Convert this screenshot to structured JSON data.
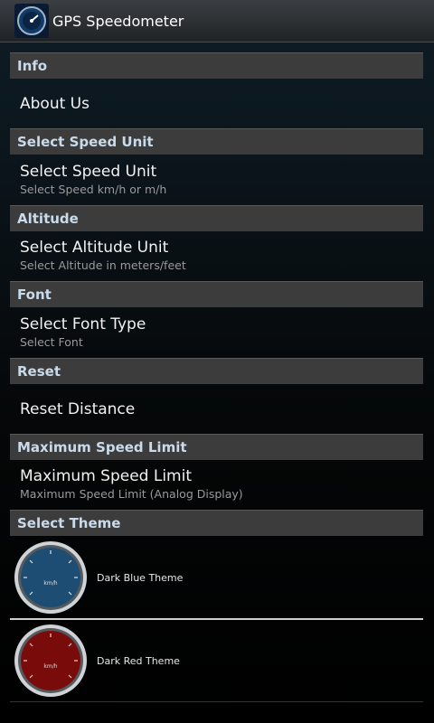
{
  "app": {
    "title": "GPS Speedometer"
  },
  "sections": {
    "info": {
      "header": "Info",
      "item_title": "About Us"
    },
    "speed": {
      "header": "Select Speed Unit",
      "item_title": "Select Speed Unit",
      "item_sub": "Select Speed km/h or m/h"
    },
    "altitude": {
      "header": "Altitude",
      "item_title": "Select Altitude Unit",
      "item_sub": "Select Altitude in meters/feet"
    },
    "font": {
      "header": "Font",
      "item_title": "Select Font Type",
      "item_sub": "Select Font"
    },
    "reset": {
      "header": "Reset",
      "item_title": "Reset Distance"
    },
    "maxspeed": {
      "header": "Maximum Speed Limit",
      "item_title": "Maximum Speed Limit",
      "item_sub": "Maximum Speed Limit (Analog Display)"
    },
    "theme": {
      "header": "Select Theme",
      "items": [
        {
          "label": "Dark Blue Theme",
          "gauge_unit": "km/h",
          "color": "#1e4d73",
          "icon": "speedometer-blue-icon"
        },
        {
          "label": "Dark Red Theme",
          "gauge_unit": "km/h",
          "color": "#7a0b0b",
          "icon": "speedometer-red-icon"
        }
      ]
    }
  },
  "colors": {
    "header_bg": "#3c3c3c",
    "header_text": "#c9dbeb",
    "background": "#000000"
  }
}
